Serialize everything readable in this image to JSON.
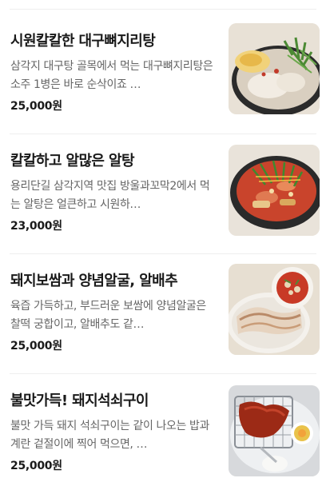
{
  "menu": {
    "items": [
      {
        "name": "시원칼칼한 대구뼈지리탕",
        "description": "삼각지 대구탕 골목에서 먹는 대구뼈지리탕은 소주 1병은 바로 순삭이죠 …",
        "price": "25,000원",
        "photo_icon": "fish-bone-soup-photo"
      },
      {
        "name": "칼칼하고 알많은 알탕",
        "description": "용리단길 삼각지역 맛집 방울과꼬막2에서 먹는 알탕은 얼큰하고 시원하…",
        "price": "23,000원",
        "photo_icon": "roe-stew-photo"
      },
      {
        "name": "돼지보쌈과 양념알굴, 알배추",
        "description": "육즙 가득하고, 부드러운 보쌈에 양념알굴은 찰떡 궁합이고, 알배추도 같…",
        "price": "25,000원",
        "photo_icon": "bossam-photo"
      },
      {
        "name": "불맛가득! 돼지석쇠구이",
        "description": "불맛 가득 돼지 석쇠구이는 같이 나오는 밥과 계란 겉절이에 찍어 먹으면, …",
        "price": "25,000원",
        "photo_icon": "grilled-pork-photo"
      }
    ]
  }
}
